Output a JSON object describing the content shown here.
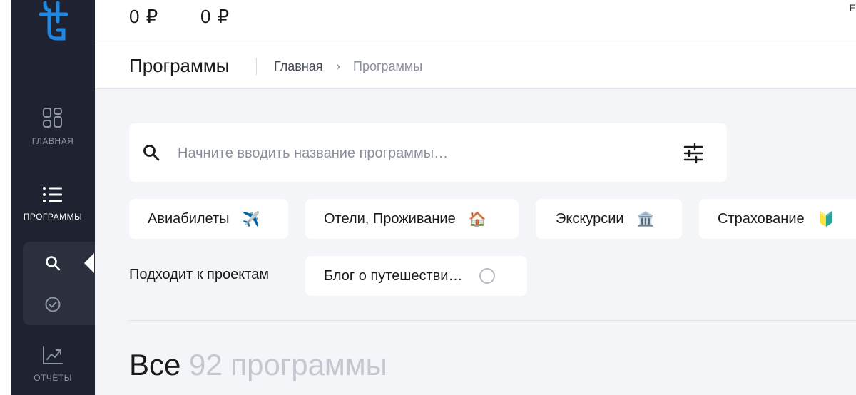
{
  "colors": {
    "sidebar_bg": "#1f2230",
    "accent_blue": "#1e88e5",
    "content_bg": "#f4f5f9"
  },
  "sidebar": {
    "items": [
      {
        "label": "ГЛАВНАЯ",
        "icon": "dashboard-grid-icon"
      },
      {
        "label": "ПРОГРАММЫ",
        "icon": "list-icon",
        "active": true
      },
      {
        "label": "ОТЧЁТЫ",
        "icon": "chart-trend-icon"
      }
    ],
    "submenu": [
      {
        "icon": "search-icon"
      },
      {
        "icon": "check-circle-icon"
      }
    ]
  },
  "topbar": {
    "balances": [
      "0 ₽",
      "0 ₽"
    ],
    "corner_truncated": "Е"
  },
  "header": {
    "title": "Программы",
    "breadcrumb": [
      {
        "label": "Главная"
      },
      {
        "label": "Программы"
      }
    ],
    "breadcrumb_separator": "›"
  },
  "search": {
    "placeholder": "Начните вводить название программы…",
    "value": ""
  },
  "categories": [
    {
      "label": "Авиабилеты",
      "emoji": "✈️"
    },
    {
      "label": "Отели, Проживание",
      "emoji": "🏠"
    },
    {
      "label": "Экскурсии",
      "emoji": "🏛️"
    },
    {
      "label": "Страхование",
      "emoji": "🔰"
    }
  ],
  "project_filter": {
    "label": "Подходит к проектам",
    "chip_label": "Блог о путешестви…"
  },
  "results": {
    "title": "Все",
    "count_text": "92 программы"
  }
}
